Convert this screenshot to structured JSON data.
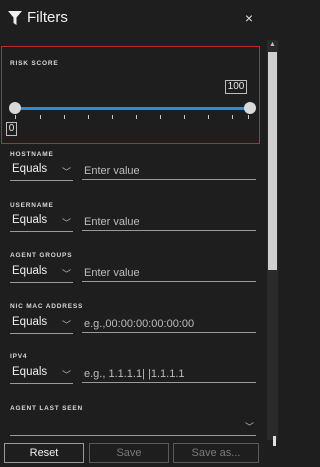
{
  "header": {
    "title": "Filters",
    "icon": "filter-icon",
    "close_label": "×"
  },
  "risk_score": {
    "label": "RISK SCORE",
    "min_value": "0",
    "max_value": "100",
    "accent_color": "#2e8bd8",
    "highlight_color": "#c0282a"
  },
  "filters": [
    {
      "label": "HOSTNAME",
      "operator": "Equals",
      "placeholder": "Enter value"
    },
    {
      "label": "USERNAME",
      "operator": "Equals",
      "placeholder": "Enter value"
    },
    {
      "label": "AGENT GROUPS",
      "operator": "Equals",
      "placeholder": "Enter value"
    },
    {
      "label": "NIC MAC ADDRESS",
      "operator": "Equals",
      "placeholder": "e.g.,00:00:00:00:00:00"
    },
    {
      "label": "IPV4",
      "operator": "Equals",
      "placeholder": "e.g., 1.1.1.1| |1.1.1.1"
    }
  ],
  "agent_last_seen": {
    "label": "AGENT LAST SEEN",
    "value": ""
  },
  "footer": {
    "reset_label": "Reset",
    "save_label": "Save",
    "save_as_label": "Save as..."
  }
}
